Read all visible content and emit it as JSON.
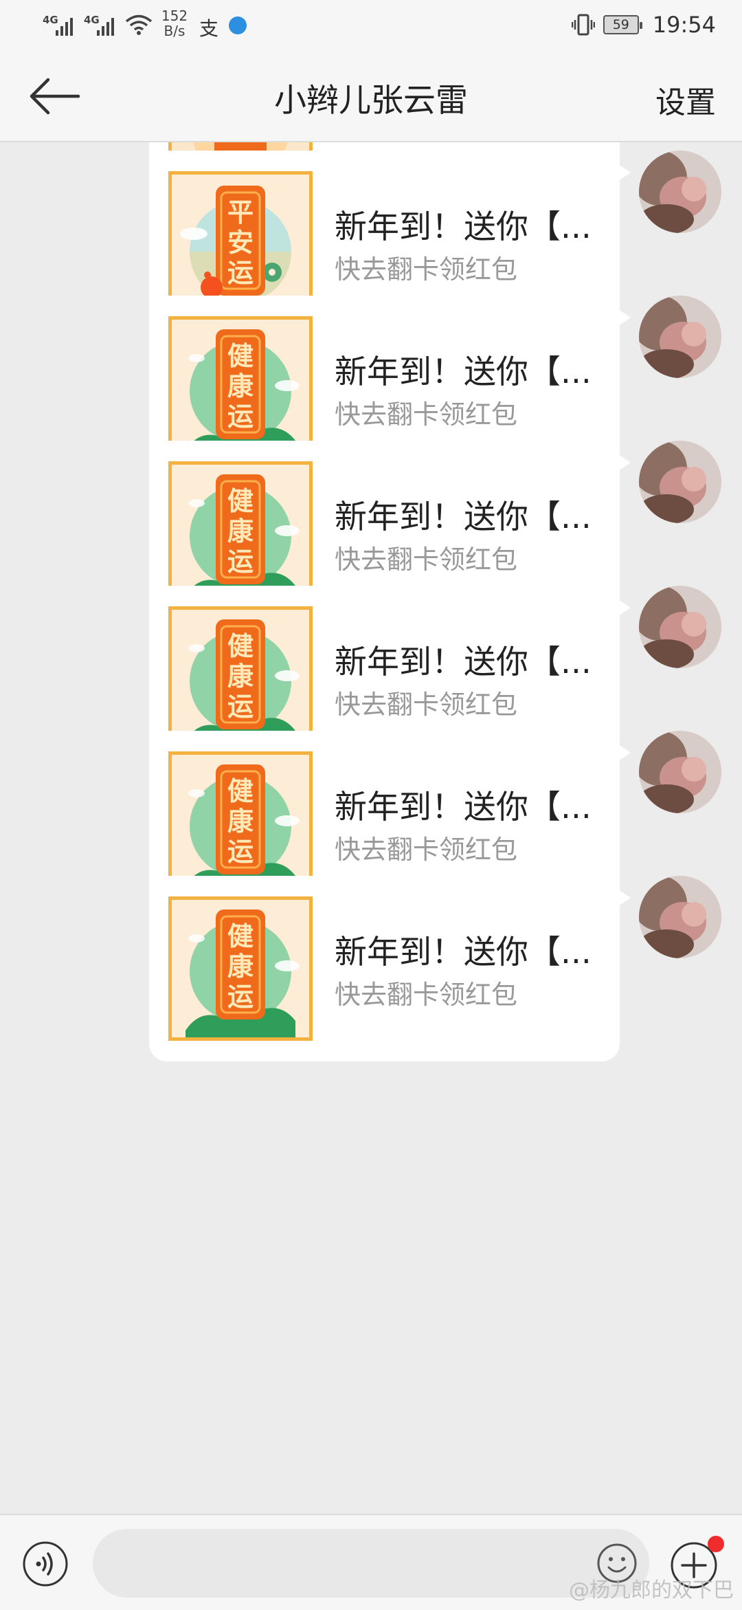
{
  "status_bar": {
    "sim1_type": "4G",
    "sim2_type": "4G",
    "net_speed_value": "152",
    "net_speed_unit": "B/s",
    "app_icon_text": "支",
    "battery": "59",
    "time": "19:54",
    "icons": [
      "signal-icon",
      "wifi-icon",
      "alipay-icon",
      "app-icon",
      "vibrate-icon",
      "battery-icon"
    ]
  },
  "header": {
    "title": "小辫儿张云雷",
    "settings_label": "设置",
    "back_icon": "arrow-left-icon"
  },
  "messages": [
    {
      "card": "partial",
      "title": "",
      "subtitle": ""
    },
    {
      "card": "平安运",
      "card_chars": [
        "平",
        "安",
        "运"
      ],
      "title": "新年到！送你【...",
      "subtitle": "快去翻卡领红包"
    },
    {
      "card": "健康运",
      "card_chars": [
        "健",
        "康",
        "运"
      ],
      "title": "新年到！送你【...",
      "subtitle": "快去翻卡领红包"
    },
    {
      "card": "健康运",
      "card_chars": [
        "健",
        "康",
        "运"
      ],
      "title": "新年到！送你【...",
      "subtitle": "快去翻卡领红包"
    },
    {
      "card": "健康运",
      "card_chars": [
        "健",
        "康",
        "运"
      ],
      "title": "新年到！送你【...",
      "subtitle": "快去翻卡领红包"
    },
    {
      "card": "健康运",
      "card_chars": [
        "健",
        "康",
        "运"
      ],
      "title": "新年到！送你【...",
      "subtitle": "快去翻卡领红包"
    },
    {
      "card": "健康运",
      "card_chars": [
        "健",
        "康",
        "运"
      ],
      "title": "新年到！送你【...",
      "subtitle": "快去翻卡领红包"
    }
  ],
  "input_bar": {
    "placeholder": "",
    "voice_icon": "voice-icon",
    "emoji_icon": "emoji-icon",
    "plus_icon": "plus-icon"
  },
  "watermark": "@杨九郎的双下巴",
  "colors": {
    "background": "#ececec",
    "bubble": "#ffffff",
    "card_border": "#f3b13f",
    "card_banner": "#f06a1c",
    "notification_dot": "#f02b2b"
  }
}
